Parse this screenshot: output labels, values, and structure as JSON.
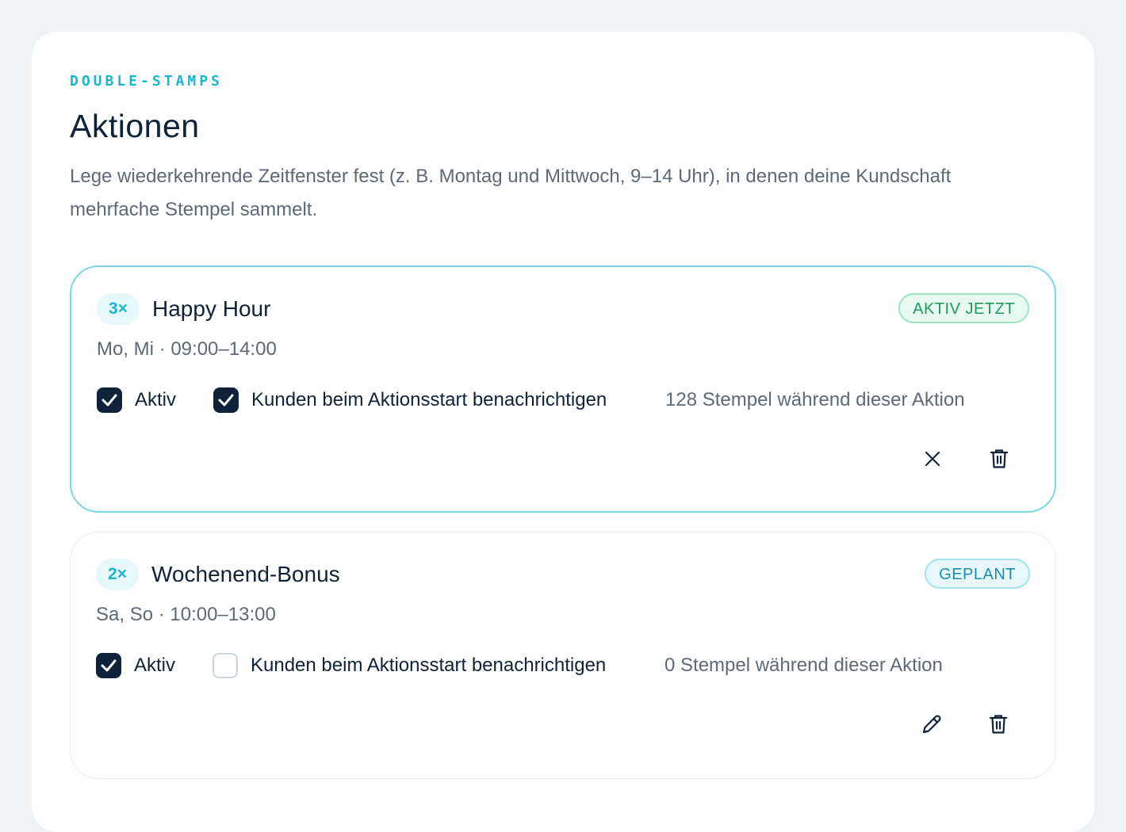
{
  "header": {
    "eyebrow": "DOUBLE-STAMPS",
    "title": "Aktionen",
    "description": "Lege wiederkehrende Zeitfenster fest (z. B. Montag und Mittwoch, 9–14 Uhr), in denen deine Kundschaft mehrfache Stempel sammelt."
  },
  "promotions": [
    {
      "multiplier": "3×",
      "name": "Happy Hour",
      "status": "AKTIV JETZT",
      "schedule": "Mo, Mi · 09:00–14:00",
      "active_label": "Aktiv",
      "active_checked": true,
      "notify_label": "Kunden beim Aktionsstart benachrichtigen",
      "notify_checked": true,
      "stamps": "128 Stempel während dieser Aktion",
      "primary_action_icon": "close-icon",
      "secondary_action_icon": "trash-icon"
    },
    {
      "multiplier": "2×",
      "name": "Wochenend-Bonus",
      "status": "GEPLANT",
      "schedule": "Sa, So · 10:00–13:00",
      "active_label": "Aktiv",
      "active_checked": true,
      "notify_label": "Kunden beim Aktionsstart benachrichtigen",
      "notify_checked": false,
      "stamps": "0 Stempel während dieser Aktion",
      "primary_action_icon": "pencil-icon",
      "secondary_action_icon": "trash-icon"
    }
  ],
  "colors": {
    "accent": "#19b7cf",
    "navy": "#0f2239",
    "muted": "#5c6a78",
    "live_green": "#1f9a5c",
    "scheduled_blue": "#1b8db0"
  }
}
